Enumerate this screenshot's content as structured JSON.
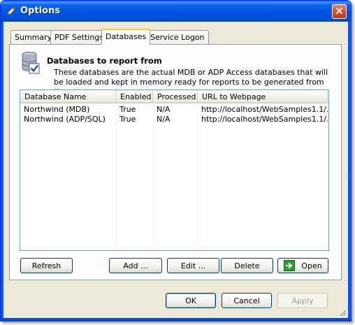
{
  "window": {
    "title": "Options"
  },
  "tabs": [
    {
      "label": "Summary"
    },
    {
      "label": "PDF Settings"
    },
    {
      "label": "Databases"
    },
    {
      "label": "Service Logon"
    }
  ],
  "section": {
    "title": "Databases to report from",
    "description": "These databases are the actual MDB or ADP Access databases that will be loaded and kept in memory ready for reports to be generated from them."
  },
  "table": {
    "columns": [
      "Database Name",
      "Enabled",
      "Processed",
      "URL to Webpage"
    ],
    "rows": [
      {
        "name": "Northwind (MDB)",
        "enabled": "True",
        "processed": "N/A",
        "url": "http://localhost/WebSamples1.1/..."
      },
      {
        "name": "Northwind (ADP/SQL)",
        "enabled": "True",
        "processed": "N/A",
        "url": "http://localhost/WebSamples1.1/..."
      }
    ]
  },
  "buttons": {
    "refresh": "Refresh",
    "add": "Add ...",
    "edit": "Edit ...",
    "delete": "Delete",
    "open": "Open",
    "ok": "OK",
    "cancel": "Cancel",
    "apply": "Apply"
  },
  "icons": {
    "title": "pen-icon",
    "close": "close-icon",
    "section": "database-check-icon",
    "open": "green-arrow-icon"
  },
  "colors": {
    "titlebar": "#0054e3",
    "close_button": "#d4512b",
    "dialog_bg": "#ece9d8",
    "active_tab_accent": "#ffc83c",
    "button_border": "#003c74"
  }
}
